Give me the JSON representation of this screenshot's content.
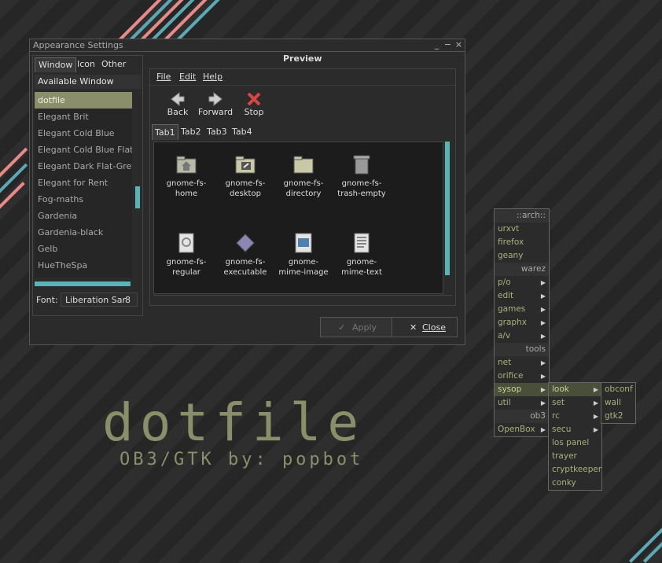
{
  "window": {
    "title": "Appearance Settings",
    "controls": {
      "minimize": "_",
      "maximize": "−",
      "close": "×"
    },
    "left_tabs": [
      "Window",
      "Icon",
      "Other"
    ],
    "themes_header": "Available Window Themes",
    "themes": [
      "dotfile",
      "Elegant Brit",
      "Elegant Cold Blue",
      "Elegant Cold Blue Flat",
      "Elegant Dark Flat-Grey",
      "Elegant for Rent",
      "Fog-maths",
      "Gardenia",
      "Gardenia-black",
      "Gelb",
      "HueTheSpa"
    ],
    "selected_theme": "dotfile",
    "font_label": "Font:",
    "font_value": "Liberation Sar",
    "font_size": "8",
    "preview_label": "Preview",
    "menus": [
      "File",
      "Edit",
      "Help"
    ],
    "tools": [
      {
        "label": "Back",
        "icon": "back-arrow-icon"
      },
      {
        "label": "Forward",
        "icon": "forward-arrow-icon"
      },
      {
        "label": "Stop",
        "icon": "stop-icon"
      }
    ],
    "preview_tabs": [
      "Tab1",
      "Tab2",
      "Tab3",
      "Tab4"
    ],
    "files": [
      {
        "name": "gnome-fs-home",
        "icon": "home-folder-icon"
      },
      {
        "name": "gnome-fs-desktop",
        "icon": "desktop-folder-icon"
      },
      {
        "name": "gnome-fs-directory",
        "icon": "folder-icon"
      },
      {
        "name": "gnome-fs-trash-empty",
        "icon": "trash-icon"
      },
      {
        "name": "gnome-fs-regular",
        "icon": "regular-file-icon"
      },
      {
        "name": "gnome-fs-executable",
        "icon": "executable-icon"
      },
      {
        "name": "gnome-mime-image",
        "icon": "image-file-icon"
      },
      {
        "name": "gnome-mime-text",
        "icon": "text-file-icon"
      }
    ],
    "apply_label": "Apply",
    "close_label": "Close"
  },
  "dock_menu": {
    "col1": [
      {
        "label": "::arch::",
        "kind": "hdr"
      },
      {
        "label": "urxvt"
      },
      {
        "label": "firefox"
      },
      {
        "label": "geany"
      },
      {
        "label": "warez",
        "kind": "hdr"
      },
      {
        "label": "p/o",
        "sub": true
      },
      {
        "label": "edit",
        "sub": true
      },
      {
        "label": "games",
        "sub": true
      },
      {
        "label": "graphx",
        "sub": true
      },
      {
        "label": "a/v",
        "sub": true
      },
      {
        "label": "tools",
        "kind": "hdr"
      },
      {
        "label": "net",
        "sub": true
      },
      {
        "label": "orifice",
        "sub": true
      },
      {
        "label": "sysop",
        "sub": true,
        "selected": true
      },
      {
        "label": "util",
        "sub": true
      },
      {
        "label": "ob3",
        "kind": "hdr"
      },
      {
        "label": "OpenBox",
        "sub": true
      }
    ],
    "col2": [
      {
        "label": "look",
        "sub": true,
        "selected": true
      },
      {
        "label": "set",
        "sub": true
      },
      {
        "label": "rc",
        "sub": true
      },
      {
        "label": "secu",
        "sub": true
      },
      {
        "label": "los panel"
      },
      {
        "label": "trayer"
      },
      {
        "label": "cryptkeeper"
      },
      {
        "label": "conky"
      }
    ],
    "col3": [
      {
        "label": "obconf"
      },
      {
        "label": "wall"
      },
      {
        "label": "gtk2"
      }
    ]
  },
  "branding": {
    "title": "dotfile",
    "subtitle": "OB3/GTK by: popbot"
  },
  "colors": {
    "accent": "#8a8f6a",
    "scroll": "#5ab5b5",
    "stripe_pink": "#e88a88",
    "stripe_teal": "#5aa9b5"
  }
}
